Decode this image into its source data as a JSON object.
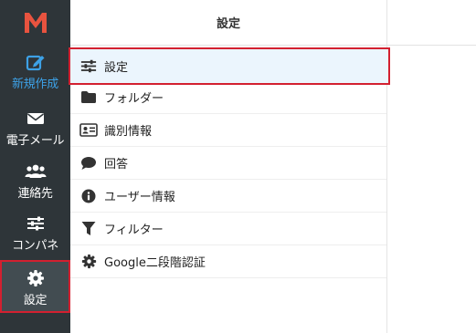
{
  "window": {
    "title": "設定"
  },
  "colors": {
    "rail_bg": "#2e3539",
    "accent": "#3da1e6",
    "highlight": "#d32030",
    "logo": "#e8533f"
  },
  "rail": {
    "items": [
      {
        "label": "新規作成",
        "icon": "compose-icon"
      },
      {
        "label": "電子メール",
        "icon": "envelope-icon"
      },
      {
        "label": "連絡先",
        "icon": "contacts-icon"
      },
      {
        "label": "コンパネ",
        "icon": "sliders-icon"
      },
      {
        "label": "設定",
        "icon": "gear-icon"
      }
    ]
  },
  "menu": {
    "items": [
      {
        "label": "設定",
        "icon": "sliders-icon"
      },
      {
        "label": "フォルダー",
        "icon": "folder-icon"
      },
      {
        "label": "識別情報",
        "icon": "id-card-icon"
      },
      {
        "label": "回答",
        "icon": "speech-bubble-icon"
      },
      {
        "label": "ユーザー情報",
        "icon": "info-icon"
      },
      {
        "label": "フィルター",
        "icon": "filter-icon"
      },
      {
        "label": "Google二段階認証",
        "icon": "gear-icon"
      }
    ]
  }
}
